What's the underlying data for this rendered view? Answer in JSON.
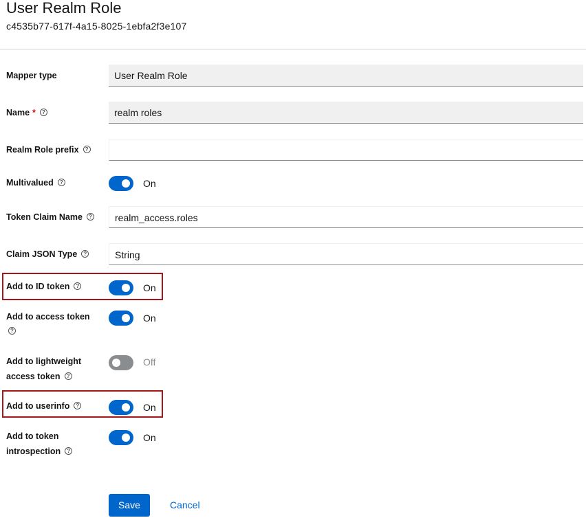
{
  "header": {
    "title": "User Realm Role",
    "subtitle": "c4535b77-617f-4a15-8025-1ebfa2f3e107"
  },
  "help_glyph": "?",
  "form": {
    "mapper_type": {
      "label": "Mapper type",
      "value": "User Realm Role"
    },
    "name": {
      "label": "Name",
      "required_mark": "*",
      "value": "realm roles"
    },
    "realm_role_prefix": {
      "label": "Realm Role prefix",
      "value": ""
    },
    "multivalued": {
      "label": "Multivalued",
      "state": "On"
    },
    "token_claim_name": {
      "label": "Token Claim Name",
      "value": "realm_access.roles"
    },
    "claim_json_type": {
      "label": "Claim JSON Type",
      "value": "String"
    },
    "add_to_id_token": {
      "label": "Add to ID token",
      "state": "On"
    },
    "add_to_access_token": {
      "label": "Add to access token",
      "state": "On"
    },
    "add_to_lightweight": {
      "label_line1": "Add to lightweight",
      "label_line2": "access token",
      "state": "Off"
    },
    "add_to_userinfo": {
      "label": "Add to userinfo",
      "state": "On"
    },
    "add_to_introspection": {
      "label_line1": "Add to token",
      "label_line2": "introspection",
      "state": "On"
    }
  },
  "actions": {
    "save_label": "Save",
    "cancel_label": "Cancel"
  },
  "colors": {
    "accent": "#0066cc",
    "highlight_border": "#a4161a",
    "toggle_off": "#8a8d90",
    "required": "#c9190b"
  },
  "icons": [
    "help-icon"
  ]
}
